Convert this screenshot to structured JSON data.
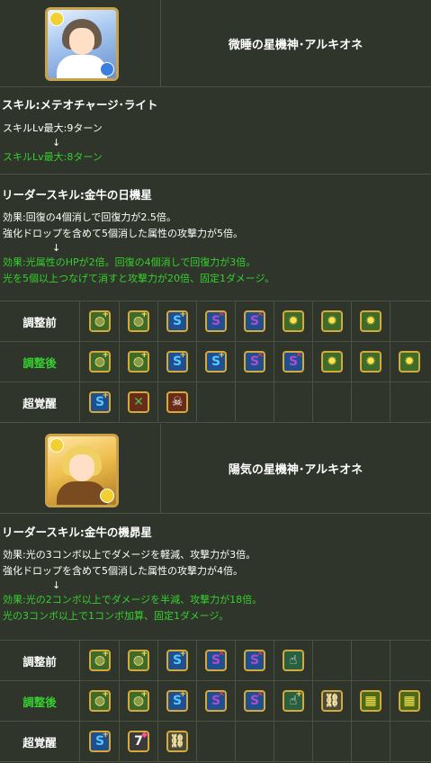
{
  "colors": {
    "background": "#2f352a",
    "border": "#4b5241",
    "text": "#ffffff",
    "green": "#35d02f",
    "icon_frame": "#d4aa3c"
  },
  "card1": {
    "name": "微睡の星機神･アルキオネ",
    "portrait_icon": "character-portrait-blue",
    "skill_title": "スキル:メテオチャージ･ライト",
    "skill_before": "スキルLv最大:9ターン",
    "skill_arrow": "↓",
    "skill_after": "スキルLv最大:8ターン",
    "leader_title": "リーダースキル:金牛の日機星",
    "leader_before": [
      "効果:回復の4個消しで回復力が2.5倍。",
      "強化ドロップを含めて5個消した属性の攻撃力が5倍。"
    ],
    "leader_arrow": "↓",
    "leader_after": [
      "効果:光属性のHPが2倍。回復の4個消しで回復力が3倍。",
      "光を5個以上つなげて消すと攻撃力が20倍、固定1ダメージ。"
    ],
    "rows": [
      {
        "label": "調整前",
        "green": false,
        "icons": [
          "light-attack-plus",
          "light-attack-plus",
          "two-way-plus",
          "dark-resist",
          "dark-resist",
          "light-row",
          "light-row",
          "light-row"
        ]
      },
      {
        "label": "調整後",
        "green": true,
        "icons": [
          "light-attack-plus",
          "light-attack-plus",
          "two-way-plus",
          "two-way-plus",
          "dark-resist",
          "dark-resist",
          "light-row",
          "light-row",
          "light-row"
        ]
      },
      {
        "label": "超覚醒",
        "green": false,
        "icons": [
          "two-way-plus",
          "wood-killer",
          "devil-killer"
        ]
      }
    ]
  },
  "card2": {
    "name": "陽気の星機神･アルキオネ",
    "portrait_icon": "character-portrait-gold",
    "leader_title": "リーダースキル:金牛の機昴星",
    "leader_before": [
      "効果:光の3コンボ以上でダメージを軽減、攻撃力が3倍。",
      "強化ドロップを含めて5個消した属性の攻撃力が4倍。"
    ],
    "leader_arrow": "↓",
    "leader_after": [
      "効果:光の2コンボ以上でダメージを半減、攻撃力が18倍。",
      "光の3コンボ以上で1コンボ加算、固定1ダメージ。"
    ],
    "rows": [
      {
        "label": "調整前",
        "green": false,
        "icons": [
          "light-attack-plus",
          "light-attack-plus",
          "two-way-plus",
          "dark-resist",
          "dark-resist",
          "finger-extend"
        ]
      },
      {
        "label": "調整後",
        "green": true,
        "icons": [
          "light-attack-plus",
          "light-attack-plus",
          "two-way-plus",
          "dark-resist",
          "dark-resist",
          "finger-extend-plus",
          "machine-killer",
          "combo-boost",
          "combo-boost"
        ]
      },
      {
        "label": "超覚醒",
        "green": false,
        "icons": [
          "two-way-plus",
          "seven-combo",
          "machine-killer"
        ]
      }
    ]
  }
}
